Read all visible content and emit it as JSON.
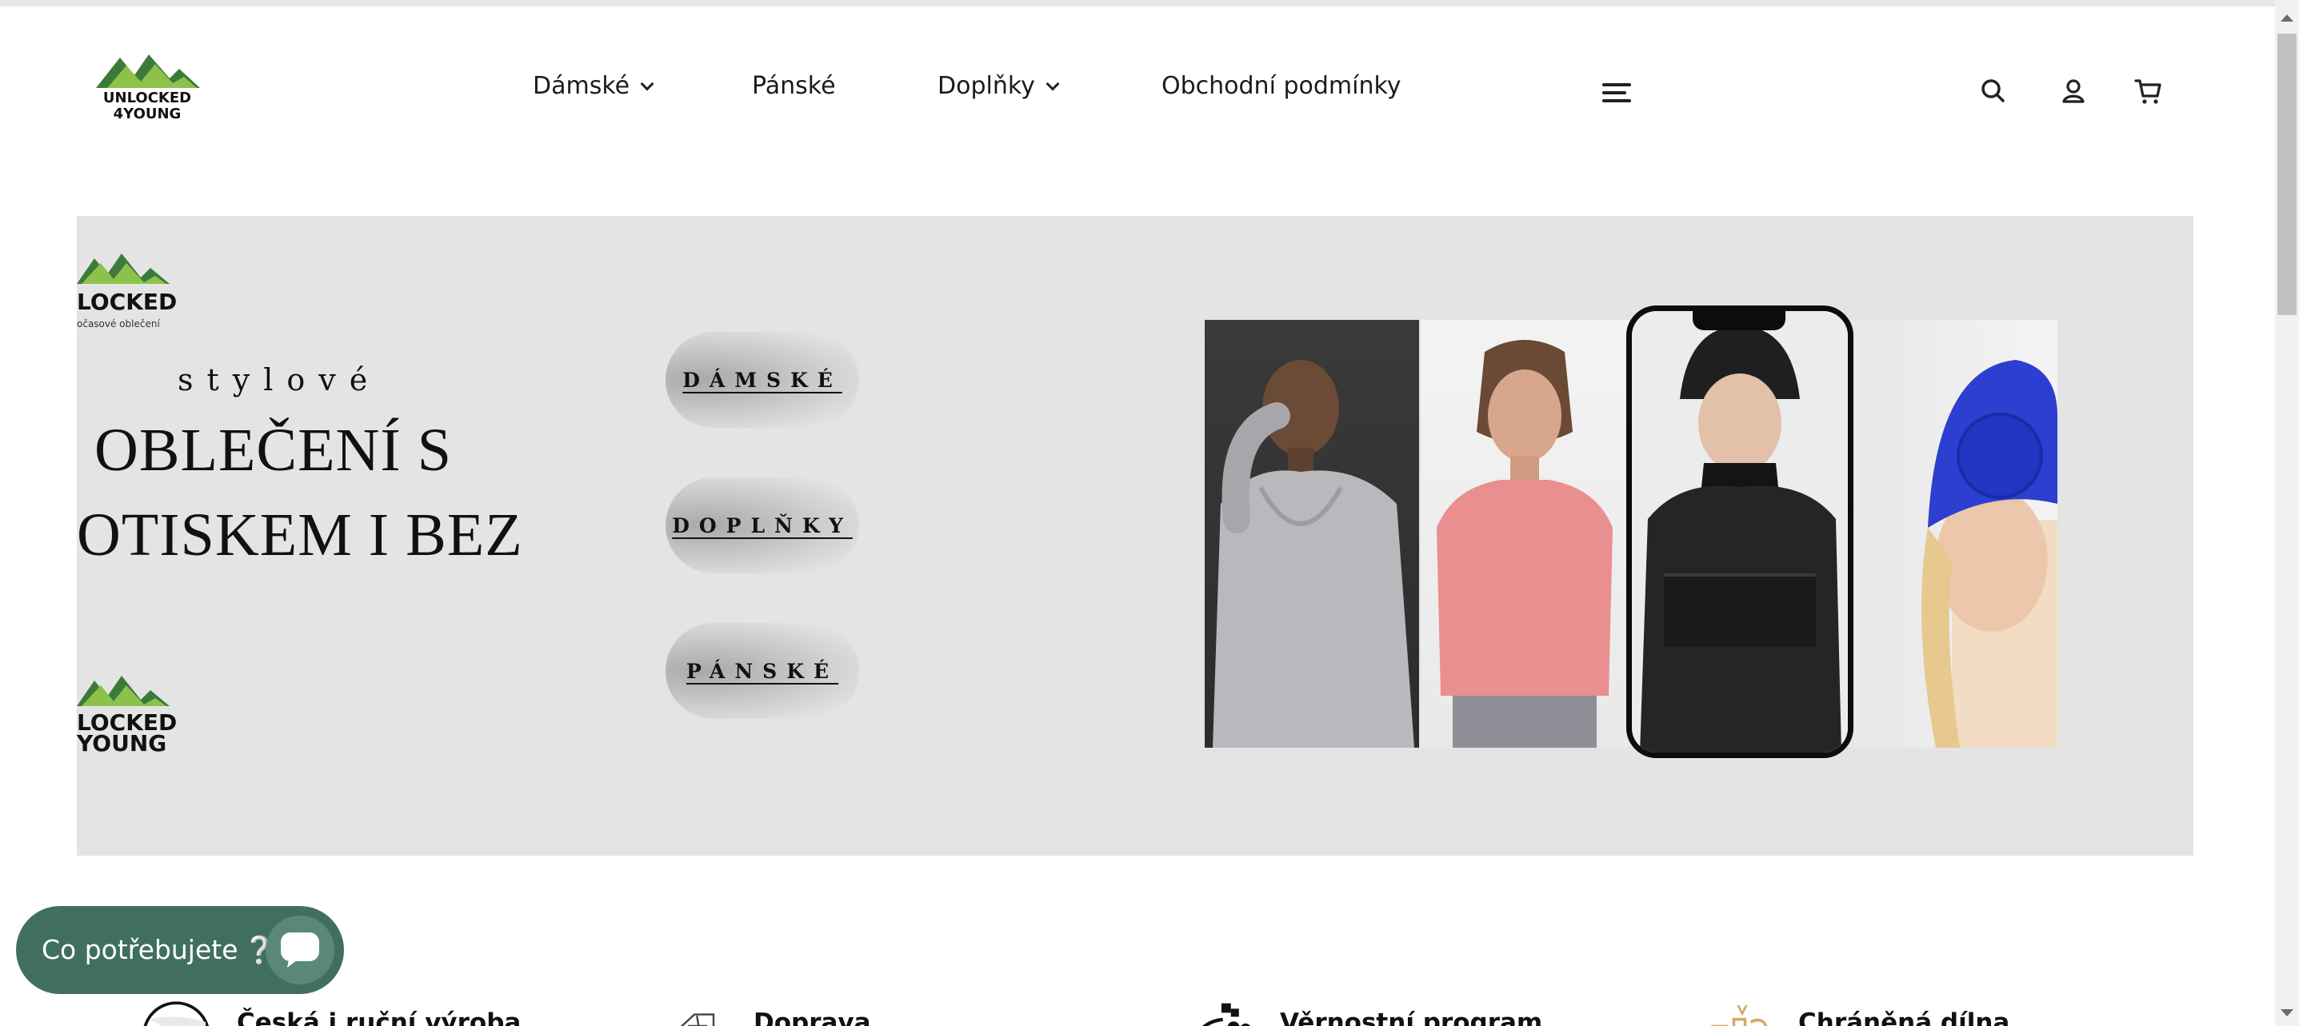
{
  "header": {
    "logo_alt": "UNLOCKED 4YOUNG",
    "nav": [
      {
        "label": "Dámské",
        "has_dropdown": true
      },
      {
        "label": "Pánské",
        "has_dropdown": false
      },
      {
        "label": "Doplňky",
        "has_dropdown": true
      },
      {
        "label": "Obchodní podmínky",
        "has_dropdown": false
      }
    ],
    "icons": [
      "menu-icon",
      "search-icon",
      "account-icon",
      "cart-icon"
    ]
  },
  "hero": {
    "logo_top_text": "LOCKED",
    "logo_top_sub": "očasové oblečení",
    "logo_bottom_text_1": "LOCKED",
    "logo_bottom_text_2": "YOUNG",
    "tagline": "stylové",
    "headline_1": "OBLEČENÍ S",
    "headline_2": "OTISKEM I BEZ",
    "buttons": [
      {
        "label": "DÁMSKÉ"
      },
      {
        "label": "DOPLŇKY"
      },
      {
        "label": "PÁNSKÉ"
      }
    ],
    "background_color": "#e4e4e4"
  },
  "features": [
    {
      "label": "Česká i ruční výroba",
      "icon": "czech-flag-icon"
    },
    {
      "label": "Doprava",
      "icon": "delivery-truck-icon"
    },
    {
      "label": "Věrnostní program",
      "icon": "loyalty-people-icon"
    },
    {
      "label": "Chráněná dílna",
      "icon": "workshop-icon"
    }
  ],
  "chat": {
    "label": "Co potřebujete",
    "emoji": "❔",
    "color": "#406f60"
  },
  "colors": {
    "logo_green_dark": "#3d7a3a",
    "logo_green_light": "#8cc24a",
    "chat_green": "#406f60"
  }
}
